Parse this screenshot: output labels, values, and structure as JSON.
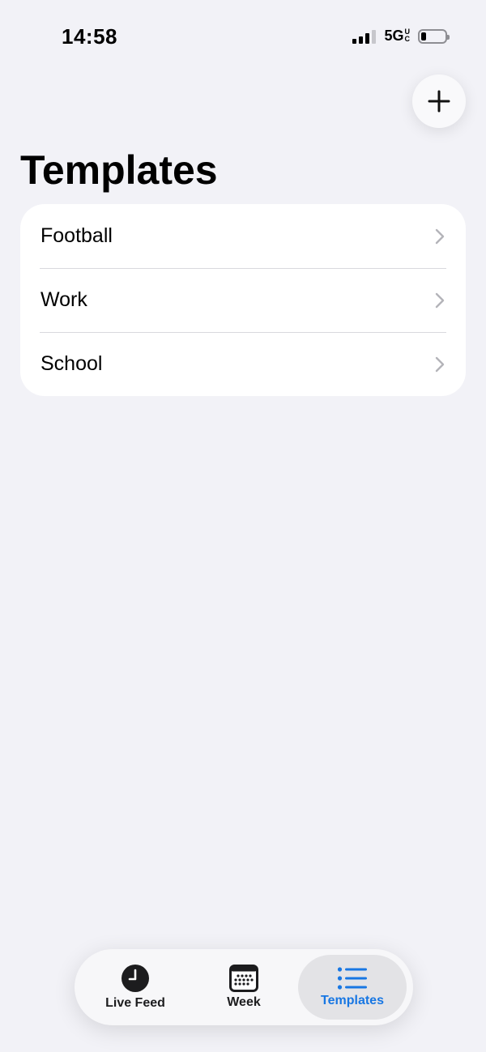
{
  "status_bar": {
    "time": "14:58",
    "network": "5G",
    "network_suffix_top": "U",
    "network_suffix_bottom": "C",
    "battery_level": 0.2
  },
  "header": {
    "add_icon": "plus-icon"
  },
  "page": {
    "title": "Templates"
  },
  "templates": [
    {
      "label": "Football",
      "icon": "chevron-right-icon"
    },
    {
      "label": "Work",
      "icon": "chevron-right-icon"
    },
    {
      "label": "School",
      "icon": "chevron-right-icon"
    }
  ],
  "tab_bar": {
    "active": "Templates",
    "active_color": "#1877e3",
    "tabs": [
      {
        "label": "Live Feed",
        "icon": "clock-icon"
      },
      {
        "label": "Week",
        "icon": "calendar-icon"
      },
      {
        "label": "Templates",
        "icon": "list-icon"
      }
    ]
  }
}
